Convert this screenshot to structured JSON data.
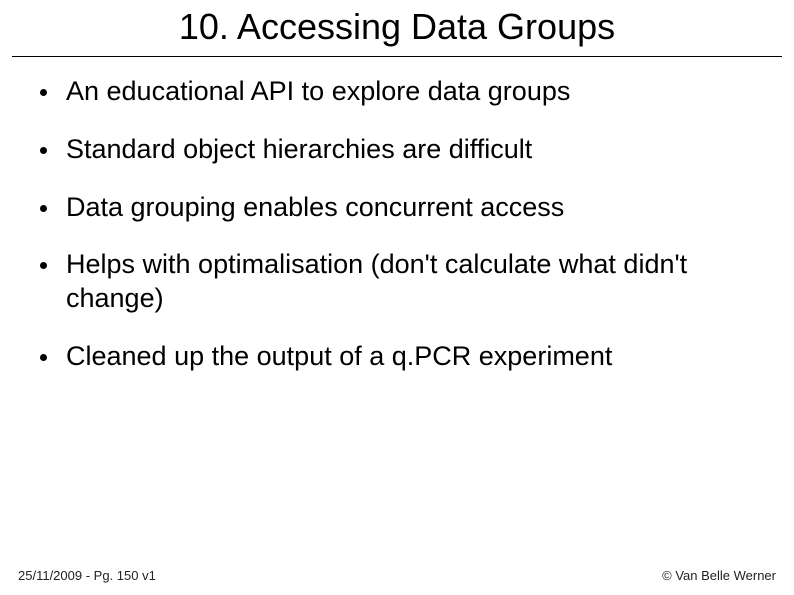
{
  "title": "10. Accessing Data Groups",
  "bullets": [
    "An educational API to explore data groups",
    "Standard object hierarchies are difficult",
    "Data grouping enables concurrent access",
    "Helps with optimalisation (don't calculate what didn't change)",
    "Cleaned up the output of a q.PCR experiment"
  ],
  "footer": {
    "left": "25/11/2009 - Pg. 150 v1",
    "right": "© Van Belle Werner"
  }
}
